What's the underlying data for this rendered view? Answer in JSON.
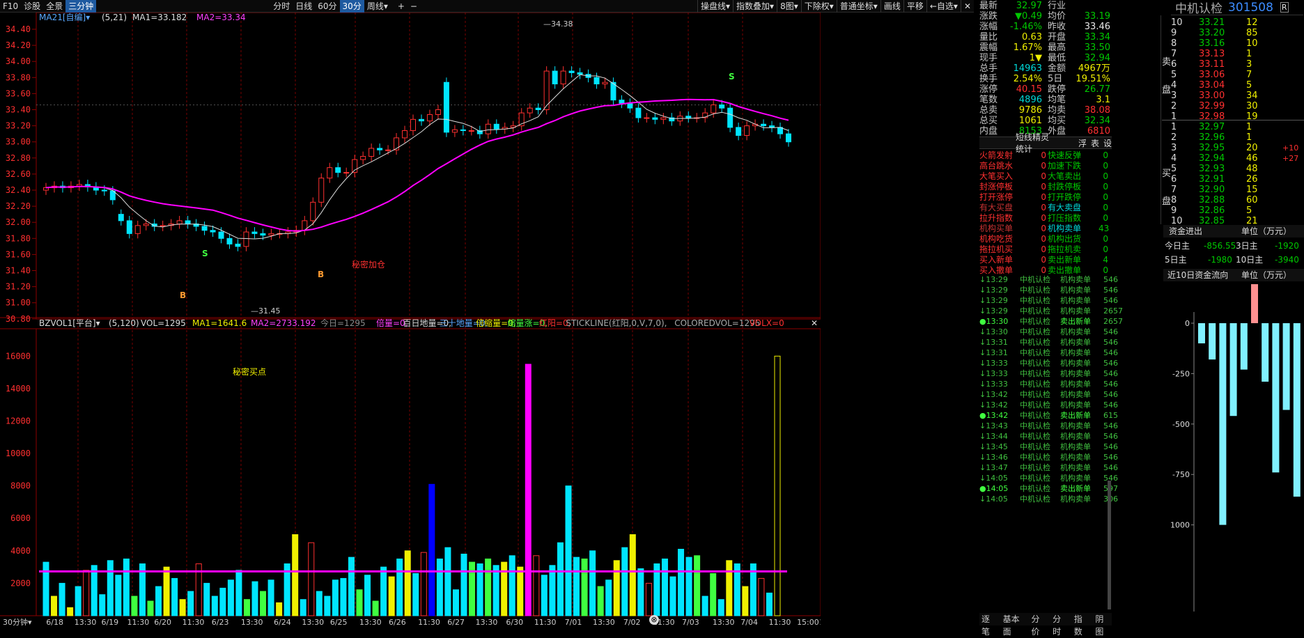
{
  "topbar": {
    "left": [
      "F10",
      "诊股",
      "全景",
      "三分钟"
    ],
    "selected_left": 3,
    "mid": [
      "分时",
      "日线",
      "60分",
      "30分",
      "周线▾"
    ],
    "selected_mid": 3,
    "mid2": [
      "+",
      "−"
    ],
    "right": [
      "操盘线▾",
      "指数叠加▾",
      "8图▾",
      "下除权▾",
      "普通坐标▾",
      "画线",
      "平移",
      "←自选▾",
      "✕"
    ]
  },
  "chart": {
    "indicator_label": "MA21[自编]▾",
    "indicator_params": "(5,21)",
    "ma1": "MA1=33.182",
    "ma2": "MA2=33.34",
    "yticks": [
      "34.40",
      "34.20",
      "34.00",
      "33.80",
      "33.60",
      "33.40",
      "33.20",
      "33.00",
      "32.80",
      "32.60",
      "32.40",
      "32.20",
      "32.00",
      "31.80",
      "31.60",
      "31.40",
      "31.20",
      "31.00",
      "30.80"
    ],
    "high_label": "34.38",
    "low_label": "31.45",
    "annot_secret_add": "秘密加仓",
    "annot_secret_buy": "秘密买点",
    "vol_title": "BZVOL1[平台]▾",
    "vol_params": "(5,120)",
    "vol": "VOL=1295",
    "vol_ma1": "MA1=1641.6",
    "vol_ma2": "MA2=2733.192",
    "vol_today": "今日=1295",
    "vol_tail": [
      "倍量=0,",
      "百日地量=0,",
      "三十地量=0,",
      "倍缩量=0,",
      "缩量涨=0,",
      "红阳=0,",
      "STICKLINE(红阳,0,V,7,0),",
      "COLOREDVOL=1295",
      "VOLX=0"
    ],
    "vol_yticks": [
      "16000",
      "14000",
      "12000",
      "10000",
      "8000",
      "6000",
      "4000",
      "2000"
    ],
    "xlabels": [
      "30分钟▾",
      "6/18",
      "13:30",
      "6/19",
      "11:30",
      "6/20",
      "11:30",
      "6/23",
      "13:30",
      "6/24",
      "13:30",
      "6/25",
      "13:30",
      "6/26",
      "11:30",
      "6/27",
      "13:30",
      "6/30",
      "11:30",
      "7/01",
      "13:30",
      "7/02",
      "11:30",
      "7/03",
      "13:30",
      "7/04",
      "11:30",
      "15:00",
      "11:30"
    ]
  },
  "quote": {
    "name": "中机认检",
    "code": "301508",
    "badge": "R",
    "rows": [
      [
        "最新",
        "32.97",
        "g",
        "行业",
        "",
        ""
      ],
      [
        "涨跌",
        "▼0.49",
        "g",
        "均价",
        "33.19",
        "g"
      ],
      [
        "涨幅",
        "-1.46%",
        "g",
        "昨收",
        "33.46",
        "w"
      ],
      [
        "量比",
        "0.63",
        "y",
        "开盘",
        "33.34",
        "g"
      ],
      [
        "震幅",
        "1.67%",
        "y",
        "最高",
        "33.50",
        "g"
      ],
      [
        "现手",
        "1▼",
        "y",
        "最低",
        "32.94",
        "g"
      ],
      [
        "总手",
        "14963",
        "c",
        "金额",
        "4967万",
        "y"
      ],
      [
        "换手",
        "2.54%",
        "y",
        "5日",
        "19.51%",
        "y"
      ],
      [
        "涨停",
        "40.15",
        "r",
        "跌停",
        "26.77",
        "g"
      ],
      [
        "笔数",
        "4896",
        "c",
        "均笔",
        "3.1",
        "y"
      ],
      [
        "总卖",
        "9786",
        "y",
        "均卖",
        "38.08",
        "r"
      ],
      [
        "总买",
        "1061",
        "y",
        "均买",
        "32.34",
        "g"
      ],
      [
        "内盘",
        "8153",
        "g",
        "外盘",
        "6810",
        "r"
      ]
    ]
  },
  "orderbook": {
    "sell": [
      [
        "10",
        "33.21",
        "12"
      ],
      [
        "9",
        "33.20",
        "85"
      ],
      [
        "8",
        "33.16",
        "10"
      ],
      [
        "7",
        "33.13",
        "1"
      ],
      [
        "6",
        "33.11",
        "3"
      ],
      [
        "5",
        "33.06",
        "7"
      ],
      [
        "4",
        "33.04",
        "5"
      ],
      [
        "3",
        "33.00",
        "34"
      ],
      [
        "2",
        "32.99",
        "30"
      ],
      [
        "1",
        "32.98",
        "19"
      ]
    ],
    "buy": [
      [
        "1",
        "32.97",
        "1",
        ""
      ],
      [
        "2",
        "32.96",
        "1",
        ""
      ],
      [
        "3",
        "32.95",
        "20",
        "+10"
      ],
      [
        "4",
        "32.94",
        "46",
        "+27"
      ],
      [
        "5",
        "32.93",
        "48",
        ""
      ],
      [
        "6",
        "32.91",
        "26",
        ""
      ],
      [
        "7",
        "32.90",
        "15",
        ""
      ],
      [
        "8",
        "32.88",
        "60",
        ""
      ],
      [
        "9",
        "32.86",
        "5",
        ""
      ],
      [
        "10",
        "32.85",
        "21",
        ""
      ]
    ],
    "sell_label": "卖盘",
    "buy_label": "买盘"
  },
  "signals": {
    "title": "短线精灵统计",
    "tabs": [
      "浮",
      "表",
      "设"
    ],
    "rows": [
      [
        "火箭发射",
        "0",
        "快速反弹",
        "0"
      ],
      [
        "高台跳水",
        "0",
        "加速下跌",
        "0"
      ],
      [
        "大笔买入",
        "0",
        "大笔卖出",
        "0"
      ],
      [
        "封涨停板",
        "0",
        "封跌停板",
        "0"
      ],
      [
        "打开涨停",
        "0",
        "打开跌停",
        "0"
      ],
      [
        "有大买盘",
        "0",
        "有大卖盘",
        "0"
      ],
      [
        "拉升指数",
        "0",
        "打压指数",
        "0"
      ],
      [
        "机构买单",
        "0",
        "机构卖单",
        "43"
      ],
      [
        "机构吃货",
        "0",
        "机构出货",
        "0"
      ],
      [
        "拖拉机买",
        "0",
        "拖拉机卖",
        "0"
      ],
      [
        "买入新单",
        "0",
        "卖出新单",
        "4"
      ],
      [
        "买入撤单",
        "0",
        "卖出撤单",
        "0"
      ]
    ]
  },
  "ticks": [
    [
      "↓13:29",
      "中机认检",
      "机构卖单",
      "546"
    ],
    [
      "↓13:29",
      "中机认检",
      "机构卖单",
      "546"
    ],
    [
      "↓13:29",
      "中机认检",
      "机构卖单",
      "546"
    ],
    [
      "↓13:29",
      "中机认检",
      "机构卖单",
      "2657"
    ],
    [
      "●13:30",
      "中机认检",
      "卖出新单",
      "2657"
    ],
    [
      "↓13:30",
      "中机认检",
      "机构卖单",
      "546"
    ],
    [
      "↓13:31",
      "中机认检",
      "机构卖单",
      "546"
    ],
    [
      "↓13:31",
      "中机认检",
      "机构卖单",
      "546"
    ],
    [
      "↓13:33",
      "中机认检",
      "机构卖单",
      "546"
    ],
    [
      "↓13:33",
      "中机认检",
      "机构卖单",
      "546"
    ],
    [
      "↓13:33",
      "中机认检",
      "机构卖单",
      "546"
    ],
    [
      "↓13:42",
      "中机认检",
      "机构卖单",
      "546"
    ],
    [
      "↓13:42",
      "中机认检",
      "机构卖单",
      "546"
    ],
    [
      "●13:42",
      "中机认检",
      "卖出新单",
      "615"
    ],
    [
      "↓13:43",
      "中机认检",
      "机构卖单",
      "546"
    ],
    [
      "↓13:44",
      "中机认检",
      "机构卖单",
      "546"
    ],
    [
      "↓13:45",
      "中机认检",
      "机构卖单",
      "546"
    ],
    [
      "↓13:46",
      "中机认检",
      "机构卖单",
      "546"
    ],
    [
      "↓13:47",
      "中机认检",
      "机构卖单",
      "546"
    ],
    [
      "↓14:05",
      "中机认检",
      "机构卖单",
      "546"
    ],
    [
      "●14:05",
      "中机认检",
      "卖出新单",
      "597"
    ],
    [
      "↓14:05",
      "中机认检",
      "机构卖单",
      "306"
    ]
  ],
  "bottom_tabs": [
    "逐笔",
    "基本面",
    "分价",
    "分时",
    "指数",
    "阴图"
  ],
  "fundflow": {
    "title": "资金进出",
    "unit": "单位（万元）",
    "today_label": "今日主",
    "today_val": "-856.55",
    "d3_label": "3日主",
    "d3_val": "-1920",
    "d5_label": "5日主",
    "d5_val": "-1980",
    "d10_label": "10日主",
    "d10_val": "-3940",
    "chart_title": "近10日资金流向",
    "chart_unit": "单位（万元）",
    "yticks": [
      "0",
      "-250",
      "-500",
      "-750",
      "1000"
    ],
    "values": [
      -100,
      -180,
      -1000,
      -460,
      -230,
      230,
      -290,
      -740,
      -430,
      -860
    ]
  },
  "colors": {
    "up": "#ff3030",
    "down": "#00e5ff",
    "ma": "#ff40ff",
    "bg": "#000000"
  }
}
